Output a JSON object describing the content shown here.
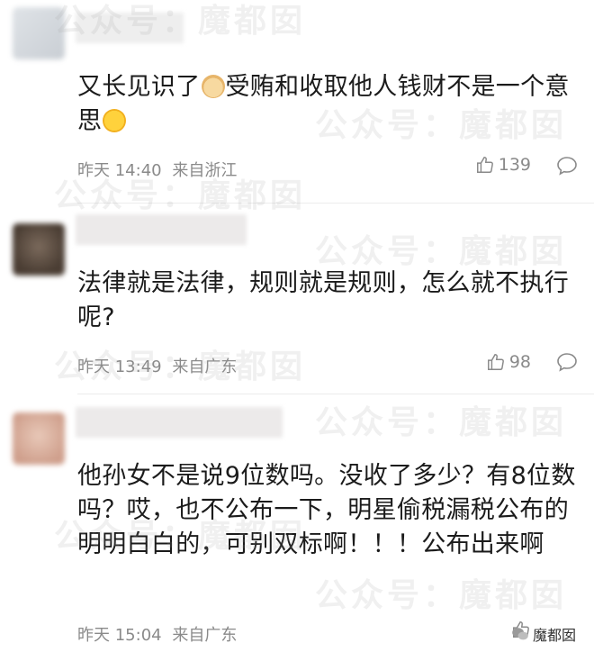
{
  "comments": [
    {
      "text_a": "又长见识了",
      "text_b": "受贿和收取他人钱财不是一个意思",
      "time": "昨天 14:40",
      "location": "来自浙江",
      "likes": "139"
    },
    {
      "text": "法律就是法律，规则就是规则，怎么就不执行呢?",
      "time": "昨天 13:49",
      "location": "来自广东",
      "likes": "98"
    },
    {
      "text": "他孙女不是说9位数吗。没收了多少？有8位数吗？哎，也不公布一下，明星偷税漏税公布的明明白白的，可别双标啊！！！公布出来啊",
      "time": "昨天 15:04",
      "location": "来自广东"
    }
  ],
  "watermark": {
    "text": "公众号：魔都囡",
    "brand": "魔都囡"
  },
  "icons": {
    "like": "thumbs-up-icon",
    "reply": "comment-bubble-icon",
    "brand": "wechat-icon"
  },
  "colors": {
    "meta": "#8a8a8a",
    "divider": "#ececec"
  }
}
